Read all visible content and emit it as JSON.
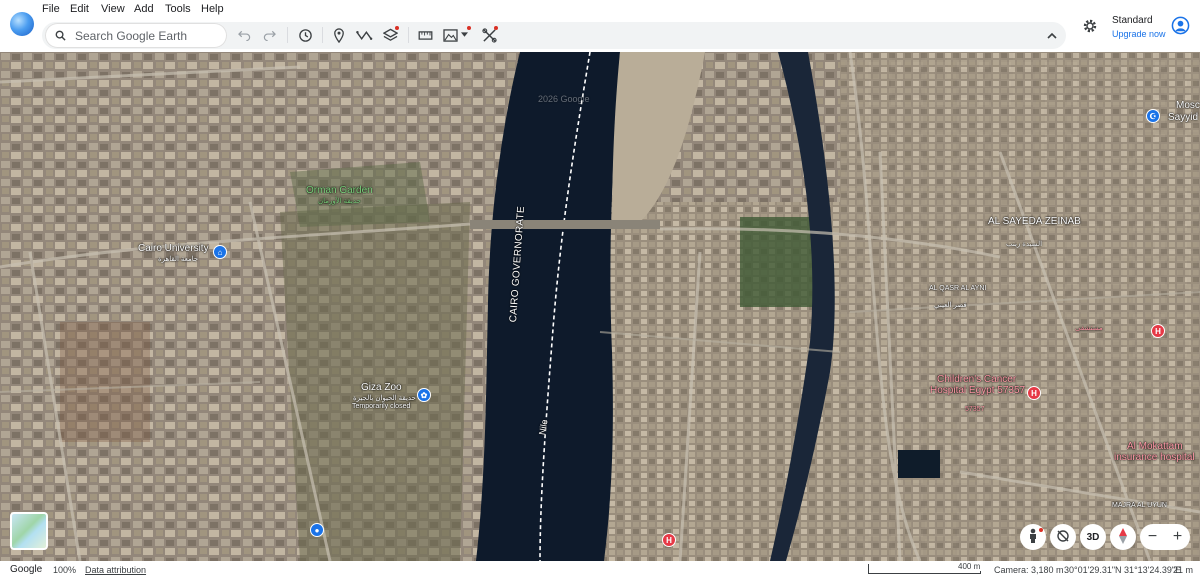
{
  "menu": [
    "File",
    "Edit",
    "View",
    "Add",
    "Tools",
    "Help"
  ],
  "search": {
    "placeholder": "Search Google Earth"
  },
  "account": {
    "plan": "Standard",
    "upgrade": "Upgrade now"
  },
  "map_labels": {
    "orman_garden": "Orman Garden",
    "orman_garden_ar": "حديقة الأورمان",
    "cairo_university": "Cairo University",
    "cairo_university_ar": "جامعة القاهرة",
    "giza_zoo": "Giza Zoo",
    "giza_zoo_ar": "حديقة الحيوان بالجيزة",
    "giza_zoo_status": "Temporarily closed",
    "governorate": "CAIRO GOVERNORATE",
    "nile": "Nile",
    "sayeda_zeinab": "AL SAYEDA ZEINAB",
    "sayeda_zeinab_ar": "السيدة زينب",
    "qasr_al_ayni": "AL QASR AL AYNI",
    "qasr_al_ayni_ar": "قصر العيني",
    "mosque_1": "Mosc",
    "mosque_2": "Sayyid",
    "children_cancer_1": "Children's Cancer",
    "children_cancer_2": "Hospital Egypt 57357",
    "children_cancer_3": "57357",
    "mokattam_1": "Al Mokattam",
    "mokattam_2": "insurance hospital",
    "majra": "MAJRA AL UYUN",
    "hospital_ar": "مستشفى",
    "watermark": "2026 Google"
  },
  "controls": {
    "three_d": "3D"
  },
  "status": {
    "brand": "Google",
    "zoom": "100%",
    "attribution": "Data attribution",
    "scale": "400 m",
    "camera": "Camera: 3,180 m",
    "coords": "30°01'29.31\"N 31°13'24.39\"E",
    "elevation": "21 m"
  },
  "colors": {
    "accent": "#1a73e8",
    "river": "#0e1a2b",
    "hospital": "#e63946"
  }
}
